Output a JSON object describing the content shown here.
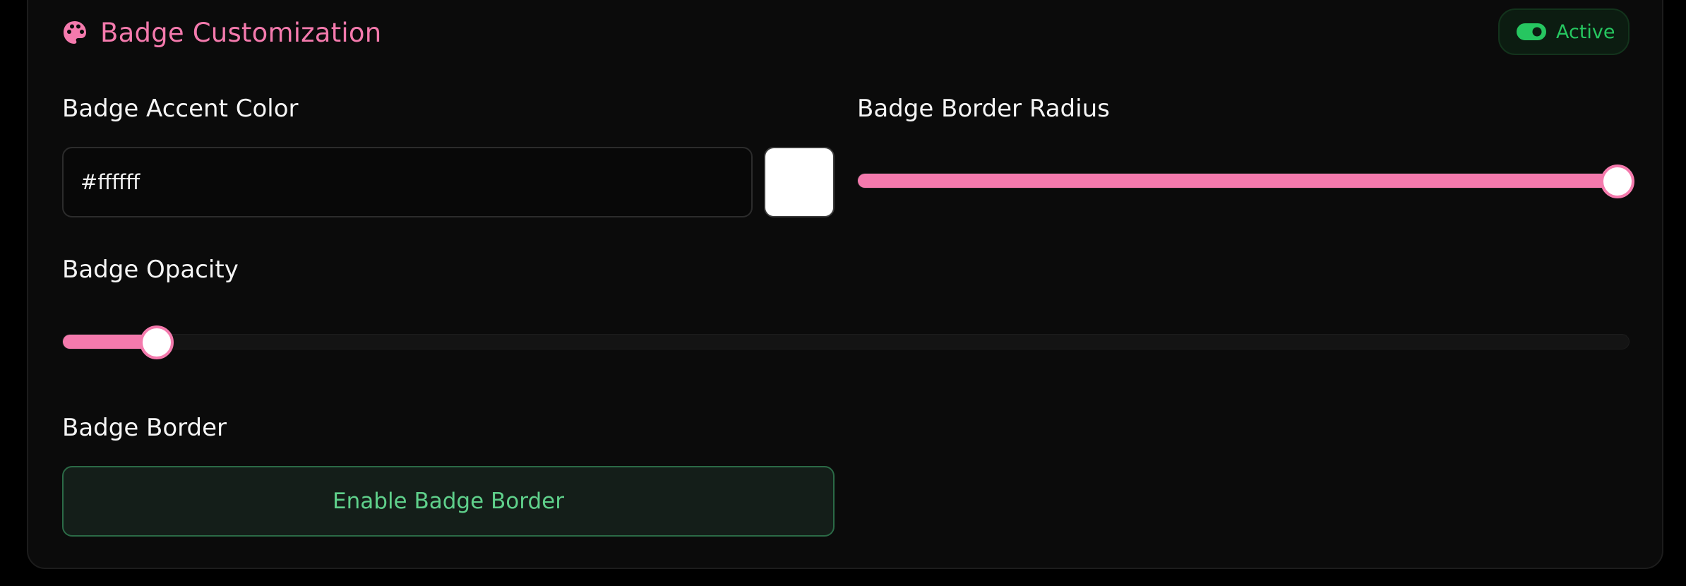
{
  "section": {
    "title": "Badge Customization",
    "icon": "palette-icon",
    "status": {
      "label": "Active",
      "icon": "toggle-on-icon",
      "color": "#26c660"
    }
  },
  "accent_color": {
    "label": "Badge Accent Color",
    "value": "#ffffff",
    "swatch_color": "#ffffff"
  },
  "border_radius": {
    "label": "Badge Border Radius",
    "fraction": 1.0
  },
  "opacity": {
    "label": "Badge Opacity",
    "fraction": 0.05
  },
  "border": {
    "label": "Badge Border",
    "button_label": "Enable Badge Border"
  },
  "colors": {
    "accent": "#f47aad",
    "active_green": "#26c660",
    "border_button_text": "#5fd08b"
  }
}
